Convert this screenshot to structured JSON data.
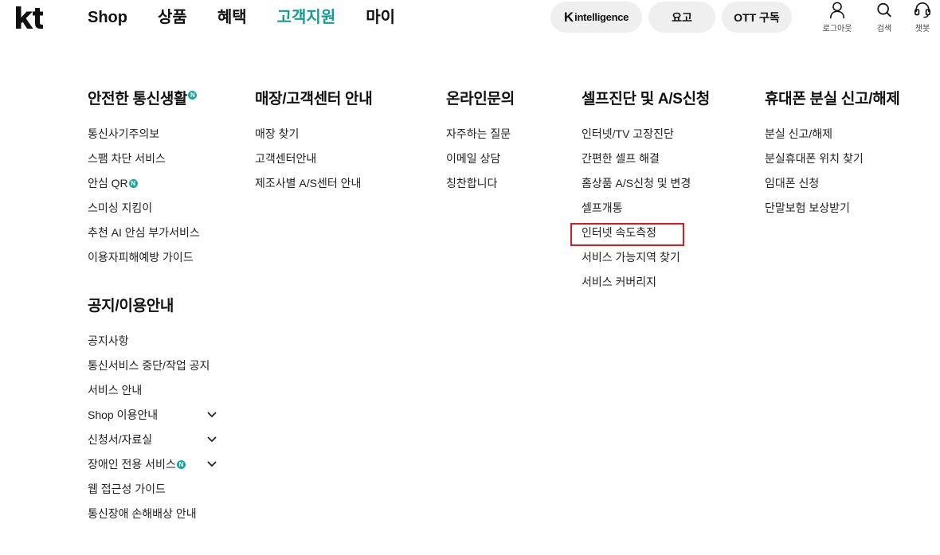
{
  "brand": {
    "logo_text": "kt"
  },
  "gnb": {
    "items": [
      {
        "label": "Shop",
        "active": false
      },
      {
        "label": "상품",
        "active": false
      },
      {
        "label": "혜택",
        "active": false
      },
      {
        "label": "고객지원",
        "active": true
      },
      {
        "label": "마이",
        "active": false
      }
    ]
  },
  "header_buttons": {
    "k_intelligence": {
      "mark": "K",
      "text": "intelligence"
    },
    "plan": "요고",
    "ott": "OTT 구독"
  },
  "utility": {
    "logout": "로그아웃",
    "search": "검색",
    "chatbot": "챗봇"
  },
  "badge": {
    "new": "N"
  },
  "columns": [
    {
      "title": "안전한 통신생활",
      "title_new": true,
      "links": [
        {
          "label": "통신사기주의보"
        },
        {
          "label": "스팸 차단 서비스"
        },
        {
          "label": "안심 QR",
          "new": true
        },
        {
          "label": "스미싱 지킴이"
        },
        {
          "label": "추천 AI 안심 부가서비스"
        },
        {
          "label": "이용자피해예방 가이드"
        }
      ]
    },
    {
      "title": "매장/고객센터 안내",
      "links": [
        {
          "label": "매장 찾기"
        },
        {
          "label": "고객센터안내"
        },
        {
          "label": "제조사별 A/S센터 안내"
        }
      ]
    },
    {
      "title": "온라인문의",
      "links": [
        {
          "label": "자주하는 질문"
        },
        {
          "label": "이메일 상담"
        },
        {
          "label": "칭찬합니다"
        }
      ]
    },
    {
      "title": "셀프진단 및 A/S신청",
      "links": [
        {
          "label": "인터넷/TV 고장진단"
        },
        {
          "label": "간편한 셀프 해결"
        },
        {
          "label": "홈상품 A/S신청 및 변경"
        },
        {
          "label": "셀프개통"
        },
        {
          "label": "인터넷 속도측정",
          "highlighted": true
        },
        {
          "label": "서비스 가능지역 찾기"
        },
        {
          "label": "서비스 커버리지"
        }
      ]
    },
    {
      "title": "휴대폰 분실 신고/해제",
      "links": [
        {
          "label": "분실 신고/해제"
        },
        {
          "label": "분실휴대폰 위치 찾기"
        },
        {
          "label": "임대폰 신청"
        },
        {
          "label": "단말보험 보상받기"
        }
      ]
    }
  ],
  "notice": {
    "title": "공지/이용안내",
    "links": [
      {
        "label": "공지사항"
      },
      {
        "label": "통신서비스 중단/작업 공지"
      },
      {
        "label": "서비스 안내"
      },
      {
        "label": "Shop 이용안내",
        "expandable": true
      },
      {
        "label": "신청서/자료실",
        "expandable": true
      },
      {
        "label": "장애인 전용 서비스",
        "new": true,
        "expandable": true
      },
      {
        "label": "웹 접근성 가이드"
      },
      {
        "label": "통신장애 손해배상 안내"
      }
    ]
  },
  "colors": {
    "accent": "#159b93",
    "badge": "#1aa69d",
    "highlight": "#e01a1a",
    "pill_bg": "#efefef"
  }
}
